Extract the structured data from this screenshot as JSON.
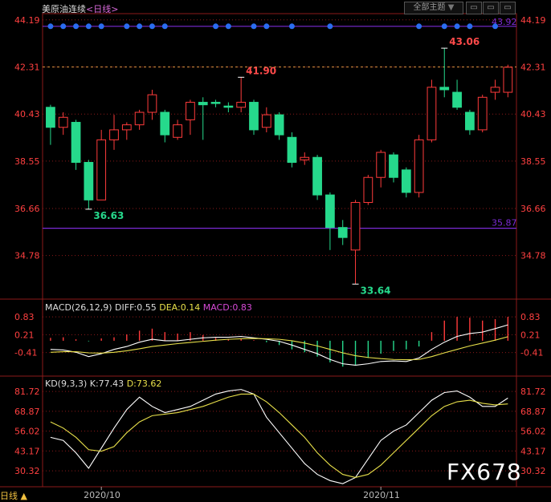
{
  "header": {
    "instrument": "美原油连续",
    "period": "<日线>",
    "theme_button": "全部主题",
    "theme_arrow": "▼"
  },
  "footer": {
    "period_label": "日线 ▲"
  },
  "watermark": "FX678",
  "colors": {
    "up": "#ff3b3b",
    "down": "#26d98c",
    "grid": "#8b1a1a",
    "white_line": "#ffffff",
    "yellow_line": "#e8e04a",
    "purple_line": "#7b2bd6",
    "dot": "#2a6df0"
  },
  "macd_legend": {
    "name": "MACD(26,12,9)",
    "diff": "DIFF:0.55",
    "dea": "DEA:0.14",
    "macd": "MACD:0.83"
  },
  "kd_legend": {
    "name": "KD(9,3,3)",
    "k": "K:77.43",
    "d": "D:73.62"
  },
  "chart_data": [
    {
      "type": "candlestick",
      "ylim": [
        33.2,
        44.6
      ],
      "yticks": [
        "44.19",
        "42.31",
        "40.43",
        "38.55",
        "36.66",
        "34.78"
      ],
      "ytick_values": [
        44.19,
        42.31,
        40.43,
        38.55,
        36.66,
        34.78
      ],
      "xticks": [
        {
          "index": 4,
          "label": "2020/10"
        },
        {
          "index": 26,
          "label": "2020/11"
        }
      ],
      "candles": [
        {
          "o": 40.7,
          "h": 40.8,
          "l": 39.2,
          "c": 39.9
        },
        {
          "o": 39.9,
          "h": 40.5,
          "l": 39.6,
          "c": 40.3
        },
        {
          "o": 40.1,
          "h": 40.2,
          "l": 38.2,
          "c": 38.5
        },
        {
          "o": 38.5,
          "h": 38.6,
          "l": 36.63,
          "c": 37.0
        },
        {
          "o": 37.0,
          "h": 39.8,
          "l": 37.0,
          "c": 39.4
        },
        {
          "o": 39.4,
          "h": 40.4,
          "l": 39.0,
          "c": 39.8
        },
        {
          "o": 39.8,
          "h": 40.1,
          "l": 39.4,
          "c": 40.0
        },
        {
          "o": 40.0,
          "h": 40.6,
          "l": 39.8,
          "c": 40.5
        },
        {
          "o": 40.5,
          "h": 41.4,
          "l": 40.2,
          "c": 41.2
        },
        {
          "o": 40.5,
          "h": 40.6,
          "l": 39.3,
          "c": 39.6
        },
        {
          "o": 39.5,
          "h": 40.2,
          "l": 39.4,
          "c": 40.0
        },
        {
          "o": 40.2,
          "h": 41.0,
          "l": 39.6,
          "c": 40.9
        },
        {
          "o": 40.9,
          "h": 41.1,
          "l": 39.4,
          "c": 40.8
        },
        {
          "o": 40.9,
          "h": 41.0,
          "l": 40.7,
          "c": 40.85
        },
        {
          "o": 40.75,
          "h": 40.9,
          "l": 40.5,
          "c": 40.7
        },
        {
          "o": 40.7,
          "h": 41.9,
          "l": 40.5,
          "c": 40.9
        },
        {
          "o": 40.9,
          "h": 41.0,
          "l": 39.6,
          "c": 39.8
        },
        {
          "o": 39.9,
          "h": 40.7,
          "l": 39.7,
          "c": 40.4
        },
        {
          "o": 40.4,
          "h": 40.5,
          "l": 39.4,
          "c": 39.6
        },
        {
          "o": 39.5,
          "h": 39.7,
          "l": 38.3,
          "c": 38.5
        },
        {
          "o": 38.6,
          "h": 38.9,
          "l": 38.4,
          "c": 38.7
        },
        {
          "o": 38.7,
          "h": 38.8,
          "l": 37.0,
          "c": 37.2
        },
        {
          "o": 37.2,
          "h": 37.3,
          "l": 35.0,
          "c": 35.9
        },
        {
          "o": 35.9,
          "h": 36.2,
          "l": 35.2,
          "c": 35.5
        },
        {
          "o": 35.0,
          "h": 37.0,
          "l": 33.64,
          "c": 36.9
        },
        {
          "o": 36.9,
          "h": 38.0,
          "l": 36.8,
          "c": 37.9
        },
        {
          "o": 37.9,
          "h": 39.0,
          "l": 37.5,
          "c": 38.9
        },
        {
          "o": 38.8,
          "h": 38.9,
          "l": 37.7,
          "c": 37.9
        },
        {
          "o": 38.2,
          "h": 38.3,
          "l": 37.1,
          "c": 37.3
        },
        {
          "o": 37.3,
          "h": 39.6,
          "l": 37.1,
          "c": 39.4
        },
        {
          "o": 39.4,
          "h": 41.8,
          "l": 39.3,
          "c": 41.5
        },
        {
          "o": 41.5,
          "h": 43.06,
          "l": 41.1,
          "c": 41.4
        },
        {
          "o": 41.3,
          "h": 41.8,
          "l": 40.6,
          "c": 40.7
        },
        {
          "o": 40.5,
          "h": 40.6,
          "l": 39.6,
          "c": 39.8
        },
        {
          "o": 39.8,
          "h": 41.2,
          "l": 39.7,
          "c": 41.1
        },
        {
          "o": 41.3,
          "h": 41.8,
          "l": 41.0,
          "c": 41.5
        },
        {
          "o": 41.3,
          "h": 42.4,
          "l": 41.1,
          "c": 42.3
        }
      ],
      "annotations": [
        {
          "index": 3,
          "value": 36.63,
          "label": "36.63",
          "kind": "low"
        },
        {
          "index": 15,
          "value": 41.9,
          "label": "41.90",
          "kind": "high"
        },
        {
          "index": 24,
          "value": 33.64,
          "label": "33.64",
          "kind": "low"
        },
        {
          "index": 31,
          "value": 43.06,
          "label": "43.06",
          "kind": "high"
        }
      ],
      "hlines": [
        {
          "value": 42.31,
          "style": "dashed"
        },
        {
          "value": 44.19,
          "label": "43.92",
          "style": "solid"
        },
        {
          "value": 35.87,
          "label": "35.87",
          "style": "solid"
        }
      ],
      "dots_at": 44.19,
      "dot_indices": [
        0,
        1,
        2,
        3,
        4,
        6,
        7,
        8,
        9,
        13,
        14,
        16,
        17,
        19,
        22,
        29,
        31,
        32,
        33,
        35
      ]
    },
    {
      "type": "macd",
      "ylim": [
        -1.2,
        1.0
      ],
      "yticks": [
        "0.83",
        "0.21",
        "-0.41"
      ],
      "ytick_values": [
        0.83,
        0.21,
        -0.41
      ],
      "hist": [
        0.1,
        0.12,
        0.05,
        -0.02,
        0.08,
        0.12,
        0.22,
        0.35,
        0.42,
        0.3,
        0.25,
        0.3,
        0.2,
        0.1,
        0.05,
        0.08,
        0.02,
        -0.05,
        -0.15,
        -0.3,
        -0.4,
        -0.55,
        -0.75,
        -0.9,
        -0.85,
        -0.6,
        -0.45,
        -0.35,
        -0.3,
        -0.2,
        0.3,
        0.7,
        0.83,
        0.8,
        0.7,
        0.75,
        0.83
      ],
      "diff": [
        -0.3,
        -0.32,
        -0.4,
        -0.55,
        -0.45,
        -0.3,
        -0.2,
        -0.05,
        0.05,
        0.0,
        0.0,
        0.05,
        0.1,
        0.12,
        0.12,
        0.15,
        0.1,
        0.05,
        -0.02,
        -0.15,
        -0.3,
        -0.45,
        -0.65,
        -0.8,
        -0.85,
        -0.8,
        -0.72,
        -0.7,
        -0.72,
        -0.6,
        -0.3,
        -0.05,
        0.15,
        0.25,
        0.3,
        0.42,
        0.55
      ],
      "dea": [
        -0.4,
        -0.38,
        -0.38,
        -0.42,
        -0.43,
        -0.4,
        -0.35,
        -0.28,
        -0.2,
        -0.15,
        -0.1,
        -0.06,
        -0.02,
        0.02,
        0.05,
        0.07,
        0.08,
        0.07,
        0.05,
        0.0,
        -0.08,
        -0.18,
        -0.3,
        -0.42,
        -0.52,
        -0.58,
        -0.62,
        -0.65,
        -0.66,
        -0.65,
        -0.55,
        -0.42,
        -0.3,
        -0.18,
        -0.08,
        0.02,
        0.14
      ]
    },
    {
      "type": "kd",
      "ylim": [
        20,
        88
      ],
      "yticks": [
        "81.72",
        "68.87",
        "56.02",
        "43.17",
        "30.32"
      ],
      "ytick_values": [
        81.72,
        68.87,
        56.02,
        43.17,
        30.32
      ],
      "k": [
        52,
        50,
        42,
        32,
        45,
        58,
        70,
        78,
        72,
        68,
        70,
        72,
        76,
        80,
        82,
        83,
        80,
        65,
        55,
        45,
        35,
        28,
        24,
        22,
        26,
        38,
        50,
        56,
        60,
        68,
        76,
        81,
        82,
        78,
        72,
        72,
        77.43
      ],
      "d": [
        62,
        58,
        52,
        44,
        43,
        46,
        55,
        62,
        66,
        67,
        68,
        70,
        72,
        75,
        78,
        80,
        80,
        75,
        68,
        60,
        52,
        42,
        34,
        28,
        26,
        28,
        34,
        42,
        50,
        58,
        66,
        72,
        75,
        76,
        74,
        73,
        73.62
      ]
    }
  ]
}
